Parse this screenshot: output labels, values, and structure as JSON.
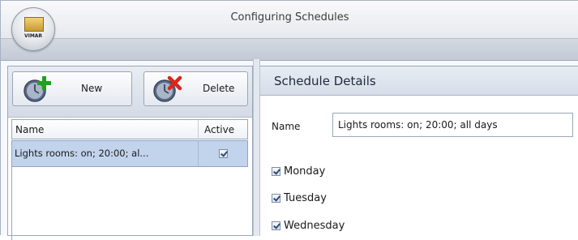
{
  "window": {
    "title": "Configuring Schedules",
    "logo_text": "VIMAR"
  },
  "toolbar": {
    "new_label": "New",
    "delete_label": "Delete"
  },
  "schedules_grid": {
    "columns": [
      "Name",
      "Active"
    ],
    "rows": [
      {
        "name": "Lights rooms: on; 20:00; al...",
        "active": true
      }
    ]
  },
  "details": {
    "title": "Schedule Details",
    "name_label": "Name",
    "name_value": "Lights rooms: on; 20:00; all days",
    "days": [
      {
        "label": "Monday",
        "checked": true
      },
      {
        "label": "Tuesday",
        "checked": true
      },
      {
        "label": "Wednesday",
        "checked": true
      }
    ]
  },
  "icons": {
    "app_logo": "vimar-logo-icon",
    "new": "clock-add-icon",
    "delete": "clock-delete-icon",
    "checkbox": "checkmark-icon"
  },
  "colors": {
    "add_green": "#1fa11f",
    "delete_red": "#d8271c",
    "selection": "#c2d3ec"
  }
}
